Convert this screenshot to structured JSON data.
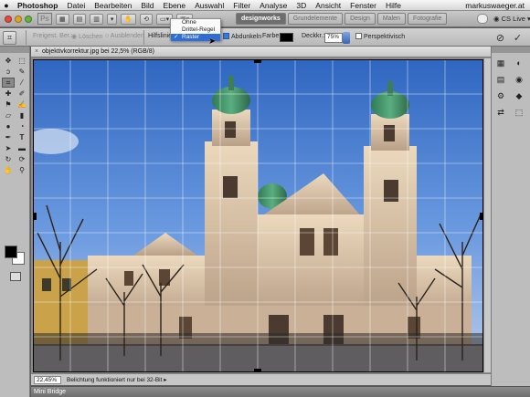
{
  "menubar": {
    "apple": "",
    "items": [
      "Photoshop",
      "Datei",
      "Bearbeiten",
      "Bild",
      "Ebene",
      "Auswahl",
      "Filter",
      "Analyse",
      "3D",
      "Ansicht",
      "Fenster",
      "Hilfe"
    ],
    "right": "markuswaeger.at"
  },
  "appbar": {
    "logo": "Ps",
    "workspaces": [
      "designworks",
      "Grundelemente",
      "Design",
      "Malen",
      "Fotografie"
    ],
    "cs_live": "CS Live"
  },
  "options": {
    "feather_label": "Freigest. Ber.:",
    "delete_label": "Löschen",
    "hide_label": "Ausblenden",
    "overlay_label": "Hilfslinie",
    "darken_label": "Abdunkeln",
    "color_label": "Farbe:",
    "opacity_label": "Deckkr.:",
    "opacity_value": "75%",
    "perspective_label": "Perspektivisch",
    "cancel_symbol": "⊘",
    "commit_symbol": "✓"
  },
  "overlay_dropdown": {
    "options": [
      "Ohne",
      "Drittel-Regel",
      "Raster"
    ],
    "selected": "Raster"
  },
  "document": {
    "tab_title": "objektivkorrektur.jpg bei 22,5% (RGB/8)",
    "zoom": "22,45%",
    "status": "Belichtung funktioniert nur bei 32-Bit"
  },
  "minibridge": {
    "label": "Mini Bridge"
  },
  "colors": {
    "foreground": "#000000",
    "background": "#ffffff",
    "accent": "#2f6fd5"
  },
  "tools": [
    "move-tool-icon",
    "marquee-tool-icon",
    "lasso-tool-icon",
    "quick-select-icon",
    "crop-tool-icon",
    "eyedropper-icon",
    "healing-brush-icon",
    "brush-icon",
    "stamp-icon",
    "history-brush-icon",
    "eraser-icon",
    "gradient-icon",
    "blur-icon",
    "dodge-icon",
    "pen-icon",
    "type-tool-icon",
    "path-select-icon",
    "shape-icon",
    "3d-rotate-icon",
    "3d-orbit-icon",
    "hand-tool-icon",
    "zoom-tool-icon"
  ],
  "panels": [
    "color-panel-icon",
    "swatches-panel-icon",
    "adjustments-panel-icon",
    "styles-panel-icon",
    "layers-panel-icon",
    "channels-panel-icon",
    "paths-panel-icon",
    "masks-panel-icon"
  ]
}
